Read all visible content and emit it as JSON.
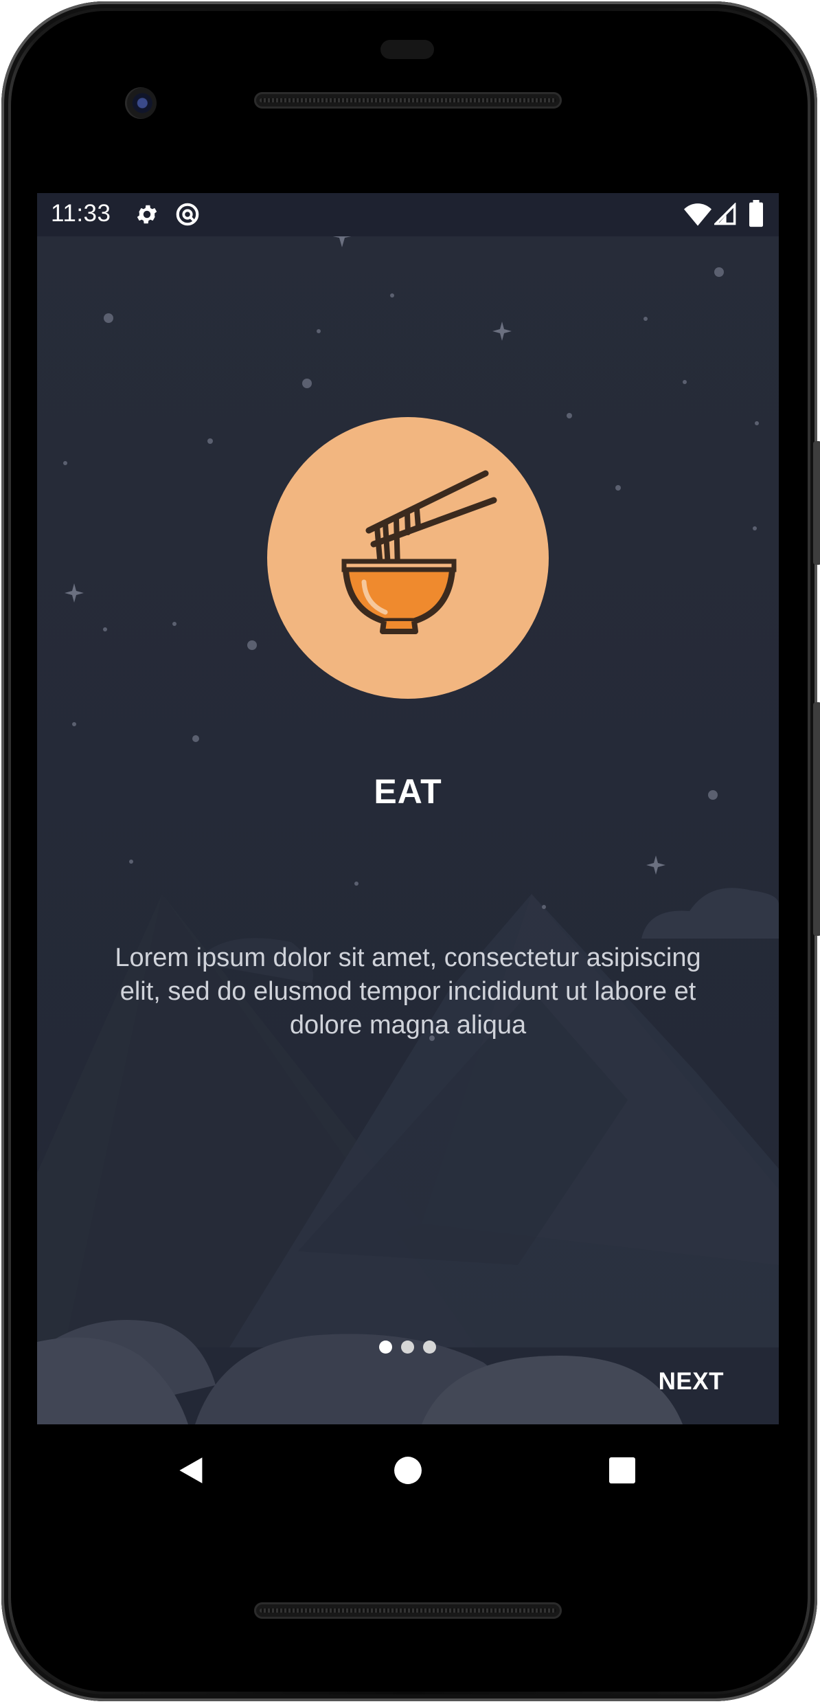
{
  "status_bar": {
    "time": "11:33",
    "left_icons": [
      "gear-icon",
      "data-saver-icon"
    ],
    "right_icons": [
      "wifi-icon",
      "signal-icon",
      "battery-icon"
    ]
  },
  "onboarding": {
    "illustration_icon": "noodle-bowl-icon",
    "title": "EAT",
    "description": "Lorem ipsum dolor sit amet, consectetur asipiscing elit, sed do elusmod tempor incididunt ut labore et dolore magna aliqua",
    "page_count": 3,
    "current_page": 1,
    "next_label": "NEXT"
  },
  "navigation_bar": {
    "buttons": [
      "back-icon",
      "home-icon",
      "recents-icon"
    ]
  },
  "colors": {
    "background": "#242a38",
    "status_bar": "#1e2230",
    "accent_circle": "#f2b680",
    "bowl": "#ef8a2e",
    "outline": "#3b2a1e",
    "text": "#ffffff"
  }
}
